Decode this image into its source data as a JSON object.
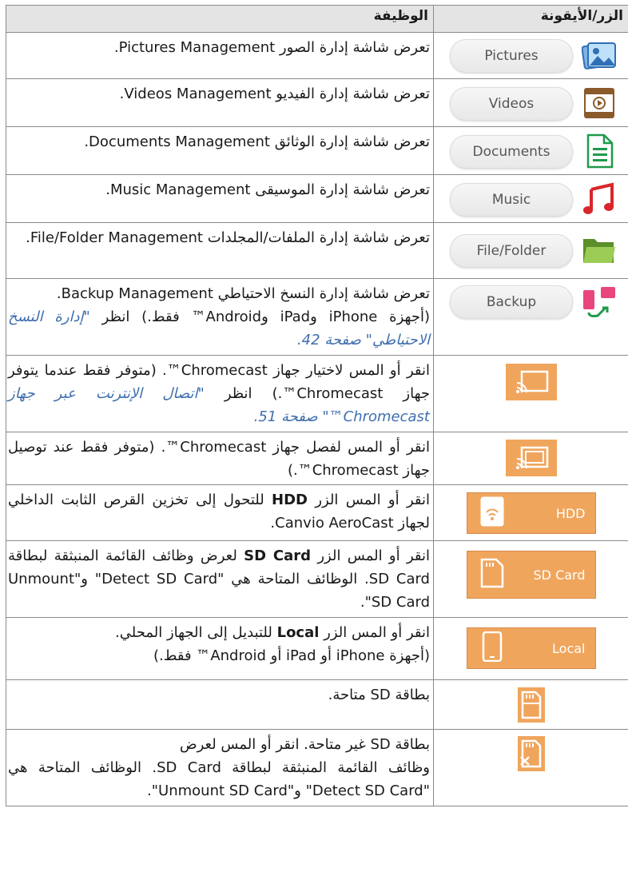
{
  "header": {
    "col_icon": "الزر/الأيقونة",
    "col_function": "الوظيفة"
  },
  "rows": [
    {
      "button": "Pictures",
      "icon": "pictures-icon",
      "text": "تعرض شاشة إدارة الصور Pictures Management."
    },
    {
      "button": "Videos",
      "icon": "videos-icon",
      "text": "تعرض شاشة إدارة الفيديو Videos Management."
    },
    {
      "button": "Documents",
      "icon": "documents-icon",
      "text": "تعرض شاشة إدارة الوثائق Documents Management."
    },
    {
      "button": "Music",
      "icon": "music-icon",
      "text": "تعرض شاشة إدارة الموسيقى Music Management."
    },
    {
      "button": "File/Folder",
      "icon": "folder-icon",
      "text": "تعرض شاشة إدارة الملفات/المجلدات File/Folder Management."
    },
    {
      "button": "Backup",
      "icon": "backup-icon",
      "text": "تعرض شاشة إدارة النسخ الاحتياطي Backup Management.",
      "text2": "(أجهزة iPhone وiPad وAndroid™ فقط.) انظر ",
      "link": "\"إدارة النسخ الاحتياطي\" صفحة 42."
    },
    {
      "icon": "cast-icon",
      "text": "انقر أو المس لاختيار جهاز Chromecast™. (متوفر فقط عندما يتوفر جهاز Chromecast™.) انظر ",
      "link": "\"اتصال الإنترنت عبر جهاز Chromecast™\" صفحة 51."
    },
    {
      "icon": "cast-connected-icon",
      "text": "انقر أو المس لفصل جهاز Chromecast™. (متوفر فقط عند توصيل جهاز Chromecast™.)"
    },
    {
      "button": "HDD",
      "icon": "hdd-icon",
      "text_a": "انقر أو المس الزر ",
      "bold": "HDD",
      "text_b": " للتحول إلى تخزين القرص الثابت الداخلي لجهاز Canvio AeroCast."
    },
    {
      "button": "SD Card",
      "icon": "sd-card-icon",
      "text_a": "انقر أو المس الزر ",
      "bold": "SD Card",
      "text_b": " لعرض وظائف القائمة المنبثقة لبطاقة SD Card. الوظائف المتاحة هي \"Detect SD Card\" و\"Unmount SD Card\"."
    },
    {
      "button": "Local",
      "icon": "phone-icon",
      "text_a": "انقر أو المس الزر ",
      "bold": "Local",
      "text_b": " للتبديل إلى الجهاز المحلي.",
      "text2": "(أجهزة iPhone أو iPad أو Android™ فقط.)"
    },
    {
      "icon": "sd-available-icon",
      "text": "بطاقة SD متاحة."
    },
    {
      "icon": "sd-unavailable-icon",
      "text": "بطاقة SD غير متاحة. انقر أو المس لعرض",
      "text2": "وظائف القائمة المنبثقة لبطاقة SD Card. الوظائف المتاحة هي \"Detect SD Card\" و\"Unmount SD Card\"."
    }
  ]
}
